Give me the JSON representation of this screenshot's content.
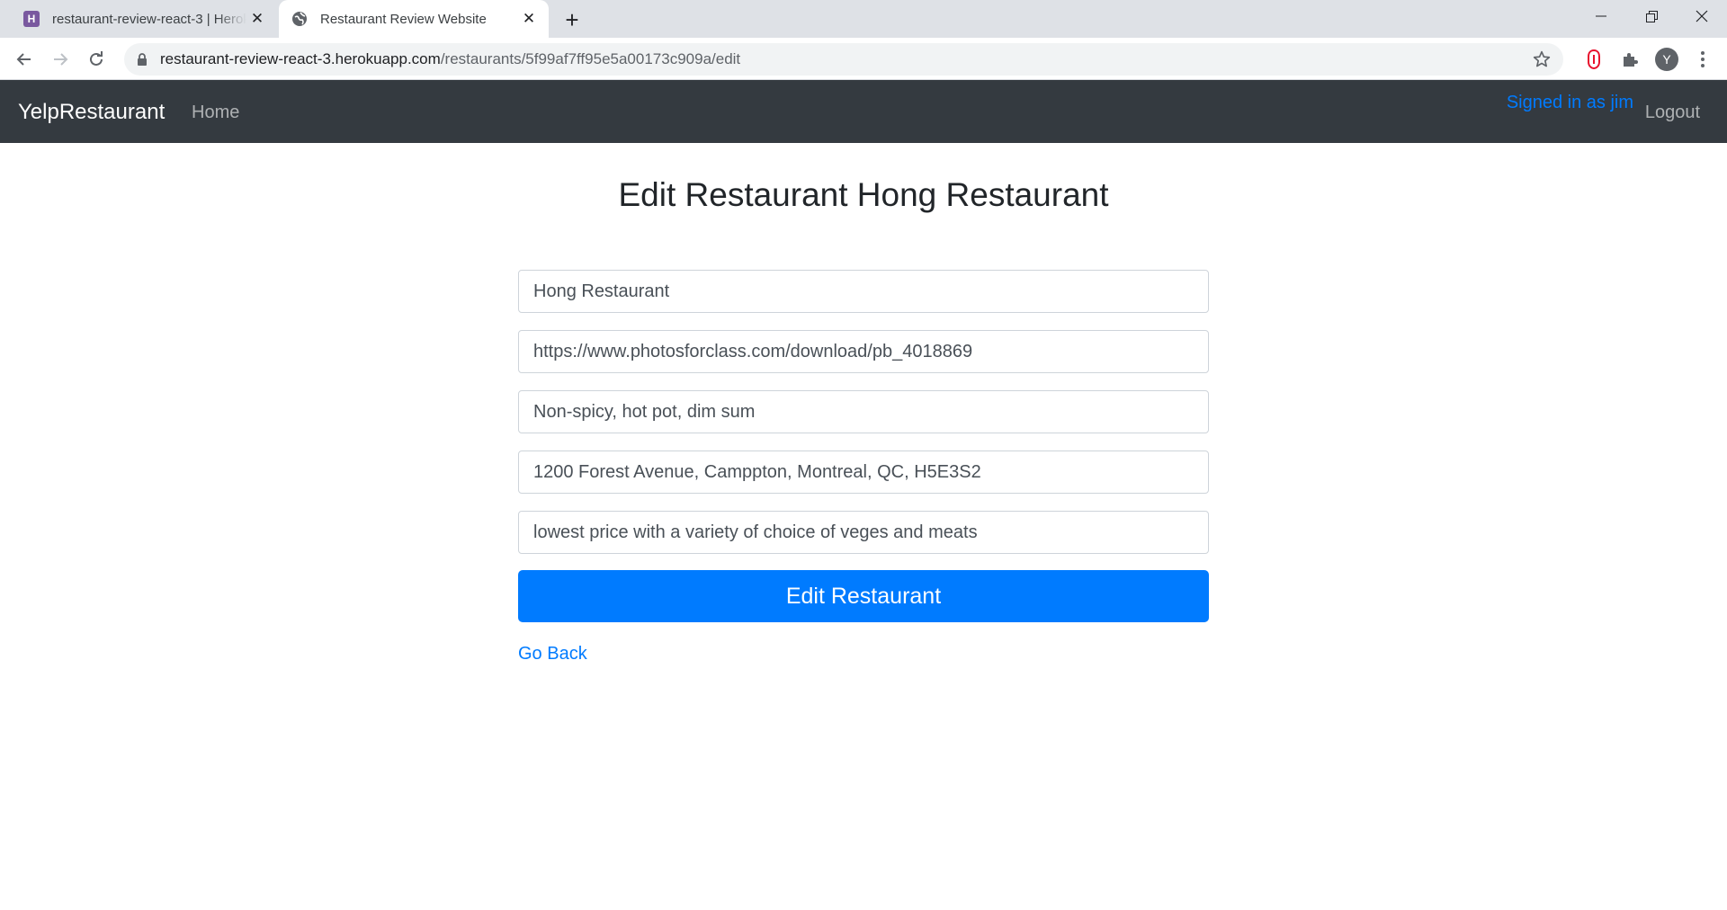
{
  "browser": {
    "tabs": [
      {
        "title": "restaurant-review-react-3 | Heroku",
        "icon": "heroku-icon",
        "favicon_letter": "H"
      },
      {
        "title": "Restaurant Review Website",
        "icon": "globe-icon",
        "active": true
      }
    ],
    "url": {
      "host": "restaurant-review-react-3.herokuapp.com",
      "path": "/restaurants/5f99af7ff95e5a00173c909a/edit"
    },
    "profile_initial": "Y"
  },
  "navbar": {
    "brand": "YelpRestaurant",
    "home": "Home",
    "signed_in": "Signed in as jim",
    "logout": "Logout"
  },
  "page": {
    "title": "Edit Restaurant Hong Restaurant",
    "fields": {
      "name": "Hong Restaurant",
      "image": "https://www.photosforclass.com/download/pb_4018869",
      "cuisine": "Non-spicy, hot pot, dim sum",
      "address": "1200 Forest Avenue, Camppton, Montreal, QC, H5E3S2",
      "description": "lowest price with a variety of choice of veges and meats"
    },
    "submit_label": "Edit Restaurant",
    "go_back": "Go Back"
  },
  "colors": {
    "navbar_bg": "#343a40",
    "primary": "#007bff",
    "chrome_tabstrip": "#dee1e6"
  }
}
